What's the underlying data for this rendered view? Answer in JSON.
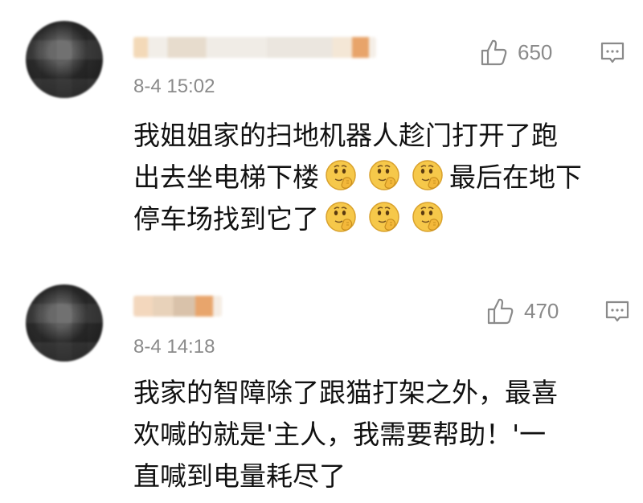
{
  "comments": [
    {
      "username": "",
      "timestamp": "8-4 15:02",
      "likes": "650",
      "body": {
        "line1": "我姐姐家的扫地机器人趁门打开了跑",
        "line2_a": "出去坐电梯下楼",
        "line2_b": "最后在地下",
        "line3": "停车场找到它了"
      },
      "emoji_icon": "thinking-face-emoji"
    },
    {
      "username": "",
      "timestamp": "8-4 14:18",
      "likes": "470",
      "body": {
        "line1": "我家的智障除了跟猫打架之外，最喜",
        "line2": "欢喊的就是'主人，我需要帮助！'一",
        "line3": "直喊到电量耗尽了"
      }
    }
  ],
  "icons": {
    "like": "thumbs-up-icon",
    "reply": "comment-bubble-icon"
  },
  "colors": {
    "text": "#111111",
    "meta": "#8a8a8a",
    "emoji": "#f6c84a"
  }
}
